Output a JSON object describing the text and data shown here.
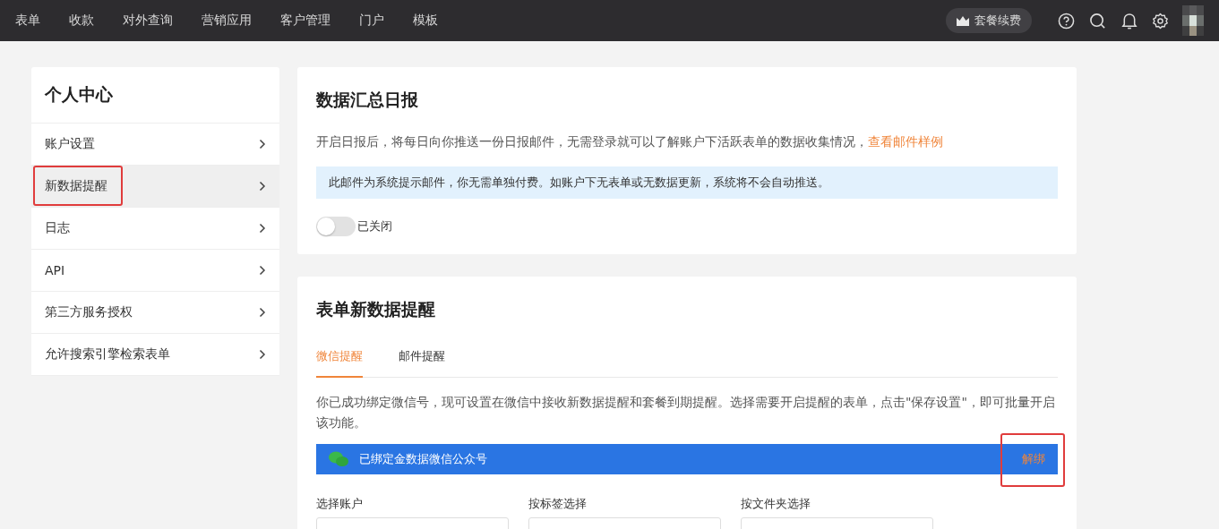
{
  "topbar": {
    "nav": [
      {
        "label": "表单"
      },
      {
        "label": "收款"
      },
      {
        "label": "对外查询"
      },
      {
        "label": "营销应用"
      },
      {
        "label": "客户管理"
      },
      {
        "label": "门户"
      },
      {
        "label": "模板"
      }
    ],
    "renew_button": "套餐续费"
  },
  "sidebar": {
    "title": "个人中心",
    "items": [
      {
        "label": "账户设置",
        "selected": false,
        "annotated": false
      },
      {
        "label": "新数据提醒",
        "selected": true,
        "annotated": true
      },
      {
        "label": "日志",
        "selected": false,
        "annotated": false
      },
      {
        "label": "API",
        "selected": false,
        "annotated": false
      },
      {
        "label": "第三方服务授权",
        "selected": false,
        "annotated": false
      },
      {
        "label": "允许搜索引擎检索表单",
        "selected": false,
        "annotated": false
      }
    ]
  },
  "daily_report": {
    "title": "数据汇总日报",
    "description": "开启日报后，将每日向你推送一份日报邮件，无需登录就可以了解账户下活跃表单的数据收集情况，",
    "link": "查看邮件样例",
    "notice": "此邮件为系统提示邮件，你无需单独付费。如账户下无表单或无数据更新，系统将不会自动推送。",
    "toggle": {
      "on": false,
      "label": "已关闭"
    }
  },
  "new_data_alert": {
    "title": "表单新数据提醒",
    "tabs": [
      {
        "label": "微信提醒",
        "selected": true
      },
      {
        "label": "邮件提醒",
        "selected": false
      }
    ],
    "description": "你已成功绑定微信号，现可设置在微信中接收新数据提醒和套餐到期提醒。选择需要开启提醒的表单，点击\"保存设置\"，即可批量开启该功能。",
    "bound_bar": {
      "text": "已绑定金数据微信公众号",
      "action": "解绑",
      "annotated": true
    },
    "filters": [
      {
        "label": "选择账户"
      },
      {
        "label": "按标签选择"
      },
      {
        "label": "按文件夹选择"
      }
    ]
  }
}
